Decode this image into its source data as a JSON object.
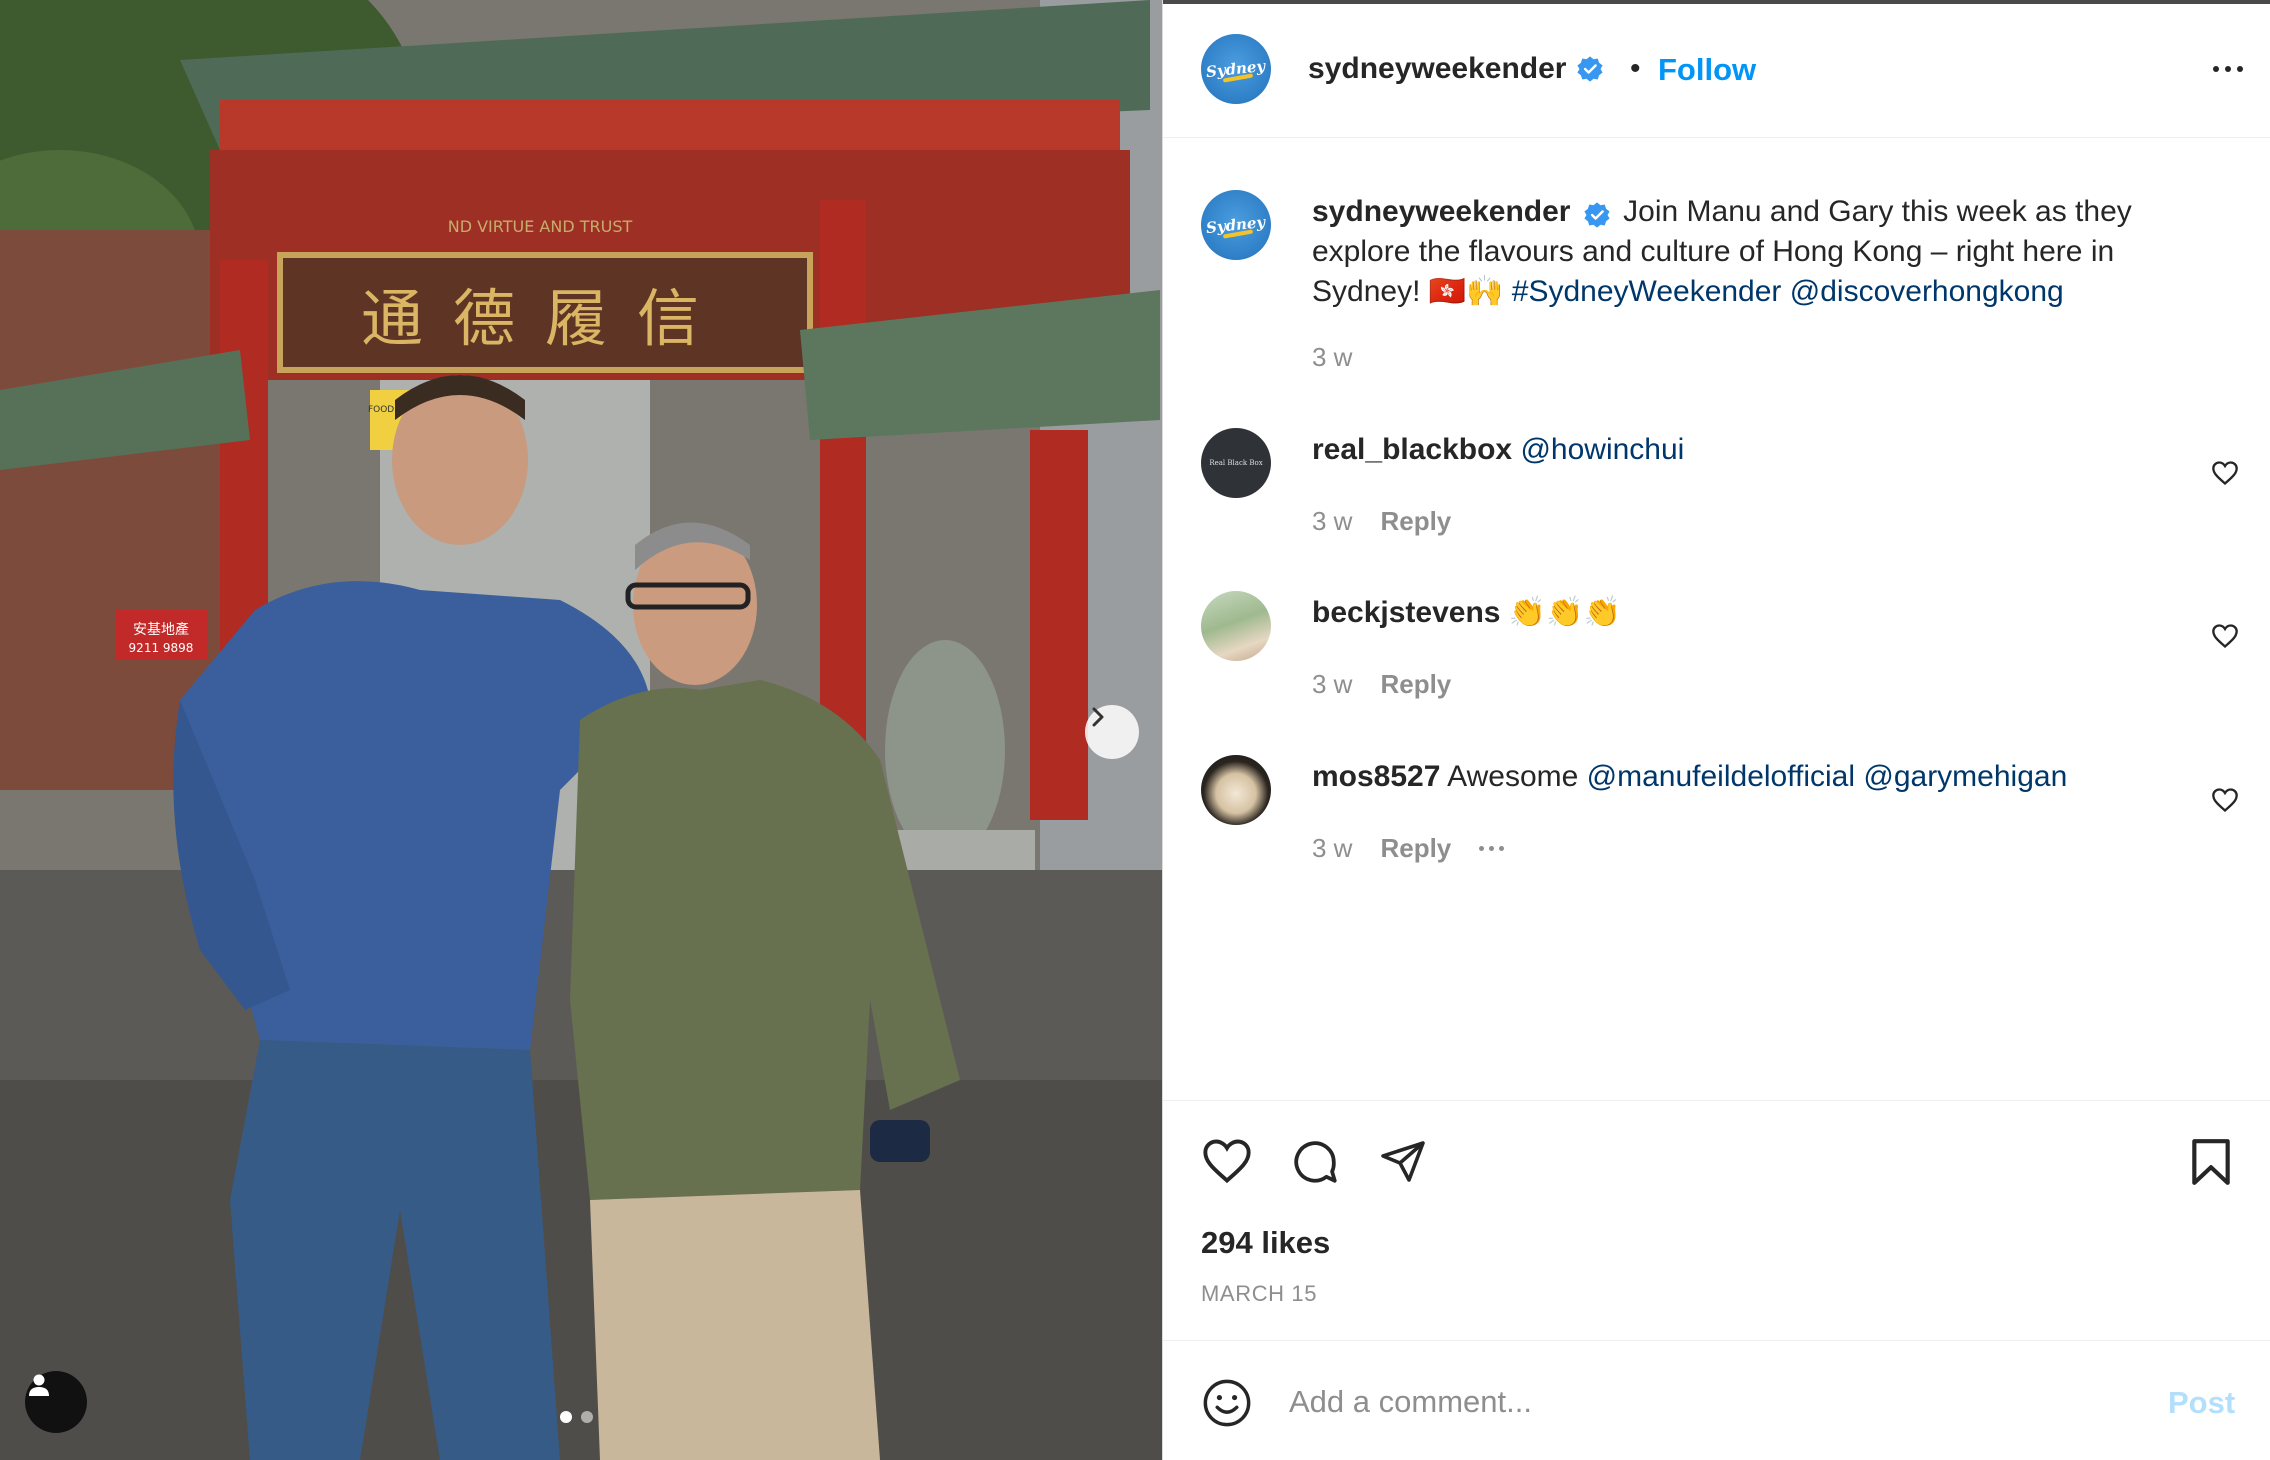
{
  "post_author": {
    "username": "sydneyweekender",
    "verified": true,
    "avatar_text": "Sydney",
    "follow_label": "Follow",
    "separator": "•"
  },
  "caption": {
    "username": "sydneyweekender",
    "text": "Join Manu and Gary this week as they explore the flavours and culture of Hong Kong – right here in Sydney! 🇭🇰🙌",
    "hashtag": "#SydneyWeekender",
    "mention": "@discoverhongkong",
    "time": "3 w"
  },
  "comments": [
    {
      "username": "real_blackbox",
      "text": "",
      "mention": "@howinchui",
      "time": "3 w",
      "reply_label": "Reply",
      "avatar_text": "Real Black Box"
    },
    {
      "username": "beckjstevens",
      "text": "👏👏👏",
      "mention": "",
      "time": "3 w",
      "reply_label": "Reply"
    },
    {
      "username": "mos8527",
      "text": "Awesome",
      "mention": "@manufeildelofficial @garymehigan",
      "time": "3 w",
      "reply_label": "Reply"
    }
  ],
  "photo": {
    "sign_text": "通德履信",
    "sign_upper": "ND VIRTUE AND TRUST",
    "food_hall": "FOOD HALL",
    "shop_sign": "安基地產",
    "shop_phone": "9211 9898",
    "carousel_count": 2,
    "carousel_active": 0
  },
  "engagement": {
    "likes": "294 likes",
    "date": "MARCH 15"
  },
  "comment_box": {
    "placeholder": "Add a comment...",
    "post_label": "Post"
  },
  "colors": {
    "accent": "#0095f6",
    "link": "#00376b",
    "muted": "#8e8e8e",
    "verified": "#3897f0"
  },
  "icons": [
    "verified-icon",
    "more-icon",
    "heart-icon",
    "comment-icon",
    "share-icon",
    "bookmark-icon",
    "emoji-icon",
    "next-arrow-icon",
    "tagged-user-icon"
  ]
}
